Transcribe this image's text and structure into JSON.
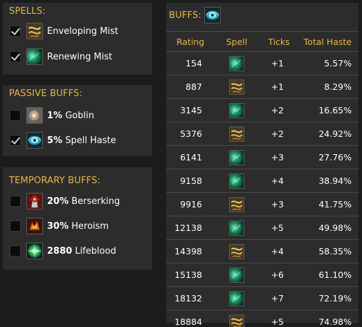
{
  "spells": {
    "title": "SPELLS:",
    "items": [
      {
        "label": "Enveloping Mist",
        "checked": true,
        "icon": "enveloping-mist-icon"
      },
      {
        "label": "Renewing Mist",
        "checked": true,
        "icon": "renewing-mist-icon"
      }
    ]
  },
  "passive": {
    "title": "PASSIVE BUFFS:",
    "items": [
      {
        "value": "1%",
        "label": "Goblin",
        "checked": false,
        "icon": "goblin-icon"
      },
      {
        "value": "5%",
        "label": "Spell Haste",
        "checked": true,
        "icon": "spell-haste-icon"
      }
    ]
  },
  "temporary": {
    "title": "TEMPORARY BUFFS:",
    "items": [
      {
        "value": "20%",
        "label": "Berserking",
        "checked": false,
        "icon": "berserking-icon"
      },
      {
        "value": "30%",
        "label": "Heroism",
        "checked": false,
        "icon": "heroism-icon"
      },
      {
        "value": "2880",
        "label": "Lifeblood",
        "checked": false,
        "icon": "lifeblood-icon"
      }
    ]
  },
  "buffs": {
    "title": "BUFFS:",
    "title_icon": "spell-haste-icon",
    "columns": [
      "Rating",
      "Spell",
      "Ticks",
      "Total Haste"
    ],
    "rows": [
      {
        "rating": "154",
        "spell": "renewing-mist-icon",
        "ticks": "+1",
        "haste": "5.57%"
      },
      {
        "rating": "887",
        "spell": "enveloping-mist-icon",
        "ticks": "+1",
        "haste": "8.29%"
      },
      {
        "rating": "3145",
        "spell": "renewing-mist-icon",
        "ticks": "+2",
        "haste": "16.65%"
      },
      {
        "rating": "5376",
        "spell": "enveloping-mist-icon",
        "ticks": "+2",
        "haste": "24.92%"
      },
      {
        "rating": "6141",
        "spell": "renewing-mist-icon",
        "ticks": "+3",
        "haste": "27.76%"
      },
      {
        "rating": "9158",
        "spell": "renewing-mist-icon",
        "ticks": "+4",
        "haste": "38.94%"
      },
      {
        "rating": "9916",
        "spell": "enveloping-mist-icon",
        "ticks": "+3",
        "haste": "41.75%"
      },
      {
        "rating": "12138",
        "spell": "renewing-mist-icon",
        "ticks": "+5",
        "haste": "49.98%"
      },
      {
        "rating": "14398",
        "spell": "enveloping-mist-icon",
        "ticks": "+4",
        "haste": "58.35%"
      },
      {
        "rating": "15138",
        "spell": "renewing-mist-icon",
        "ticks": "+6",
        "haste": "61.10%"
      },
      {
        "rating": "18132",
        "spell": "renewing-mist-icon",
        "ticks": "+7",
        "haste": "72.19%"
      },
      {
        "rating": "18884",
        "spell": "enveloping-mist-icon",
        "ticks": "+5",
        "haste": "74.98%"
      }
    ]
  },
  "colors": {
    "background": "#1c1c1c",
    "panel": "#2c2c2c",
    "heading": "#e8b844",
    "text": "#ffffff"
  }
}
